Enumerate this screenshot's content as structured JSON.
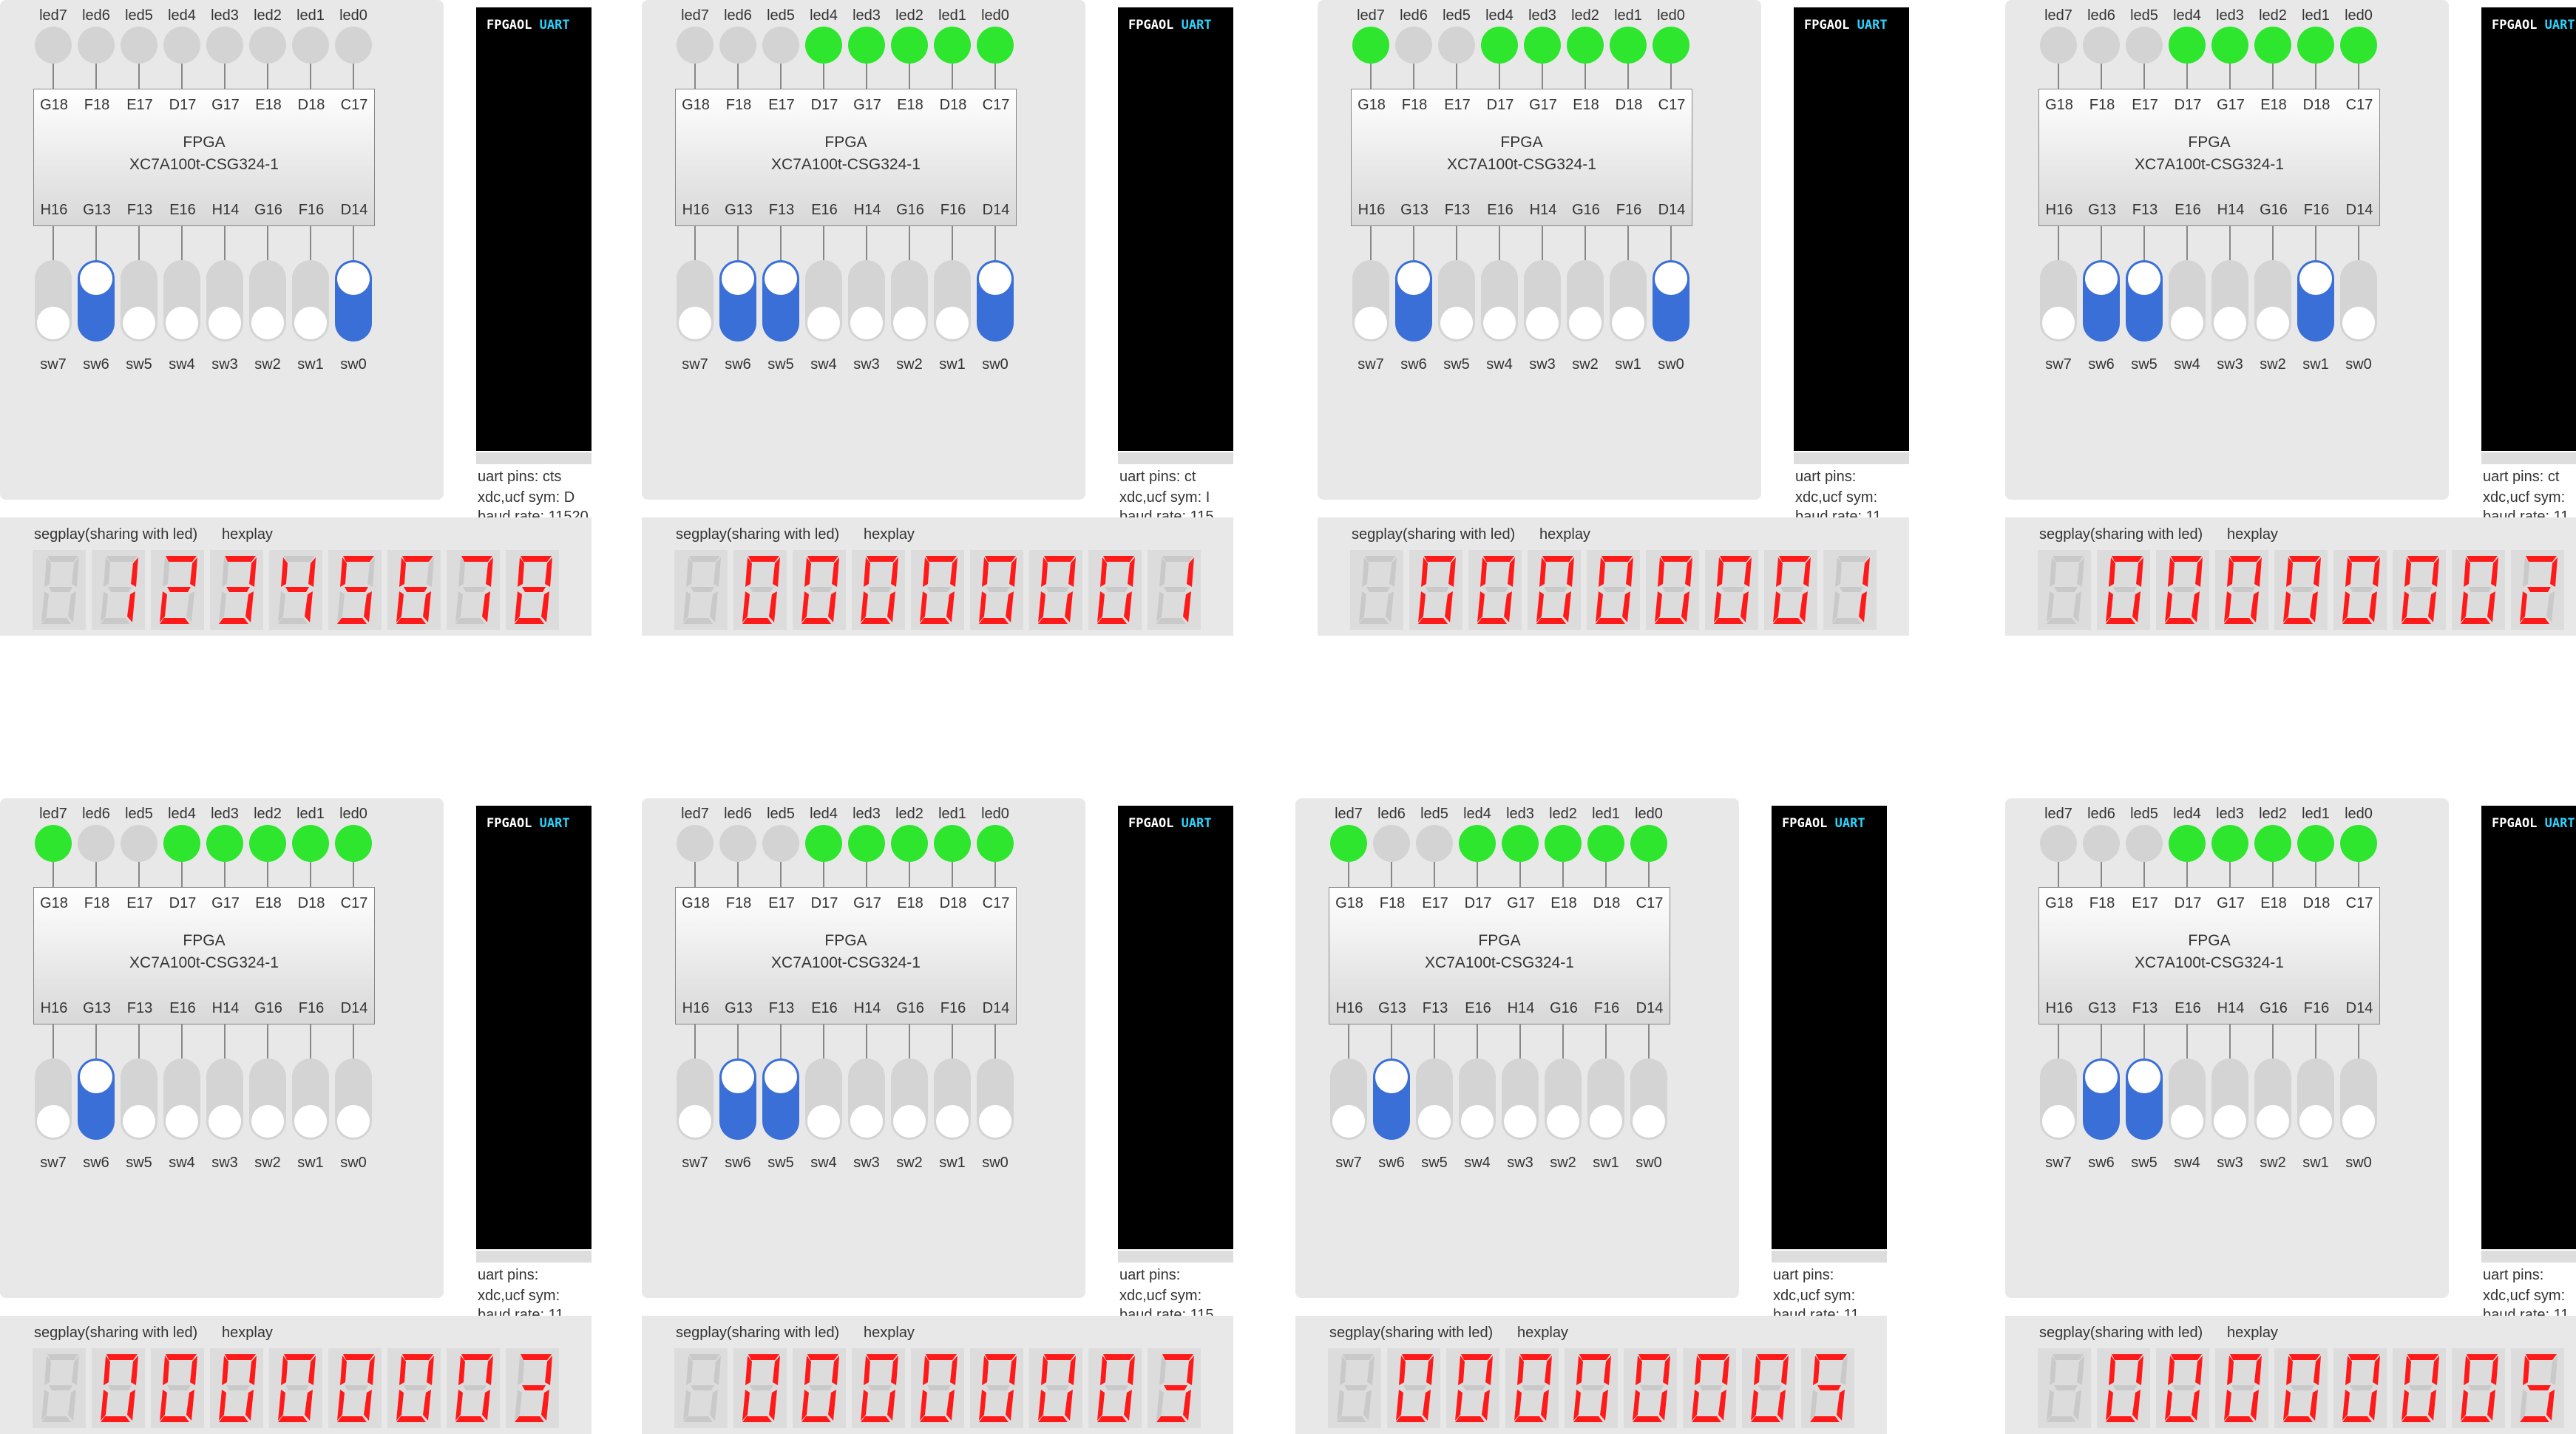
{
  "colors": {
    "led_on": "#2ee62e",
    "led_off": "#d3d3d3",
    "switch_on": "#3a6fd8",
    "switch_off": "#d4d4d4",
    "segment_on": "#ff1a1a",
    "segment_off": "#c9c9c9"
  },
  "panels": [
    {
      "leds": [
        0,
        0,
        0,
        0,
        0,
        0,
        0,
        0
      ],
      "switches": [
        0,
        1,
        0,
        0,
        0,
        0,
        0,
        1
      ],
      "digits": "12345678",
      "uart_extra": "cts",
      "xdc_extra": "D",
      "baud_extra": "baud rate: 11520"
    },
    {
      "leds": [
        0,
        0,
        0,
        1,
        1,
        1,
        1,
        1
      ],
      "switches": [
        0,
        1,
        1,
        0,
        0,
        0,
        0,
        1
      ],
      "digits": "00000001",
      "uart_extra": "ct",
      "xdc_extra": "I",
      "baud_extra": "baud rate: 115"
    },
    {
      "leds": [
        1,
        0,
        0,
        1,
        1,
        1,
        1,
        1
      ],
      "switches": [
        0,
        1,
        0,
        0,
        0,
        0,
        0,
        1
      ],
      "digits": "00000001",
      "uart_extra": "",
      "xdc_extra": "",
      "baud_extra": "baud rate: 11"
    },
    {
      "leds": [
        0,
        0,
        0,
        1,
        1,
        1,
        1,
        1
      ],
      "switches": [
        0,
        1,
        1,
        0,
        0,
        0,
        1,
        0
      ],
      "digits": "00000002",
      "uart_extra": "ct",
      "xdc_extra": "",
      "baud_extra": "baud rate: 11"
    },
    {
      "leds": [
        1,
        0,
        0,
        1,
        1,
        1,
        1,
        1
      ],
      "switches": [
        0,
        1,
        0,
        0,
        0,
        0,
        0,
        0
      ],
      "digits": "00000003",
      "uart_extra": "",
      "xdc_extra": "",
      "baud_extra": "baud rate: 11"
    },
    {
      "leds": [
        0,
        0,
        0,
        1,
        1,
        1,
        1,
        1
      ],
      "switches": [
        0,
        1,
        1,
        0,
        0,
        0,
        0,
        0
      ],
      "digits": "00000003",
      "uart_extra": "",
      "xdc_extra": "",
      "baud_extra": "baud rate: 115"
    },
    {
      "leds": [
        1,
        0,
        0,
        1,
        1,
        1,
        1,
        1
      ],
      "switches": [
        0,
        1,
        0,
        0,
        0,
        0,
        0,
        0
      ],
      "digits": "00000005",
      "uart_extra": "",
      "xdc_extra": "",
      "baud_extra": "baud rate: 11"
    },
    {
      "leds": [
        0,
        0,
        0,
        1,
        1,
        1,
        1,
        1
      ],
      "switches": [
        0,
        1,
        1,
        0,
        0,
        0,
        0,
        0
      ],
      "digits": "00000005",
      "uart_extra": "",
      "xdc_extra": "",
      "baud_extra": "baud rate: 11"
    }
  ],
  "labels": {
    "leds": [
      "led7",
      "led6",
      "led5",
      "led4",
      "led3",
      "led2",
      "led1",
      "led0"
    ],
    "led_pins": [
      "G18",
      "F18",
      "E17",
      "D17",
      "G17",
      "E18",
      "D18",
      "C17"
    ],
    "sw_pins": [
      "H16",
      "G13",
      "F13",
      "E16",
      "H14",
      "G16",
      "F16",
      "D14"
    ],
    "switches": [
      "sw7",
      "sw6",
      "sw5",
      "sw4",
      "sw3",
      "sw2",
      "sw1",
      "sw0"
    ],
    "fpga_title": "FPGA",
    "fpga_chip": "XC7A100t-CSG324-1",
    "terminal_brand": "FPGAOL",
    "terminal_mode": "UART",
    "uart_pins": "uart pins:",
    "xdc": "xdc,ucf sym:",
    "segplay": "segplay(sharing with led)",
    "hexplay": "hexplay"
  }
}
